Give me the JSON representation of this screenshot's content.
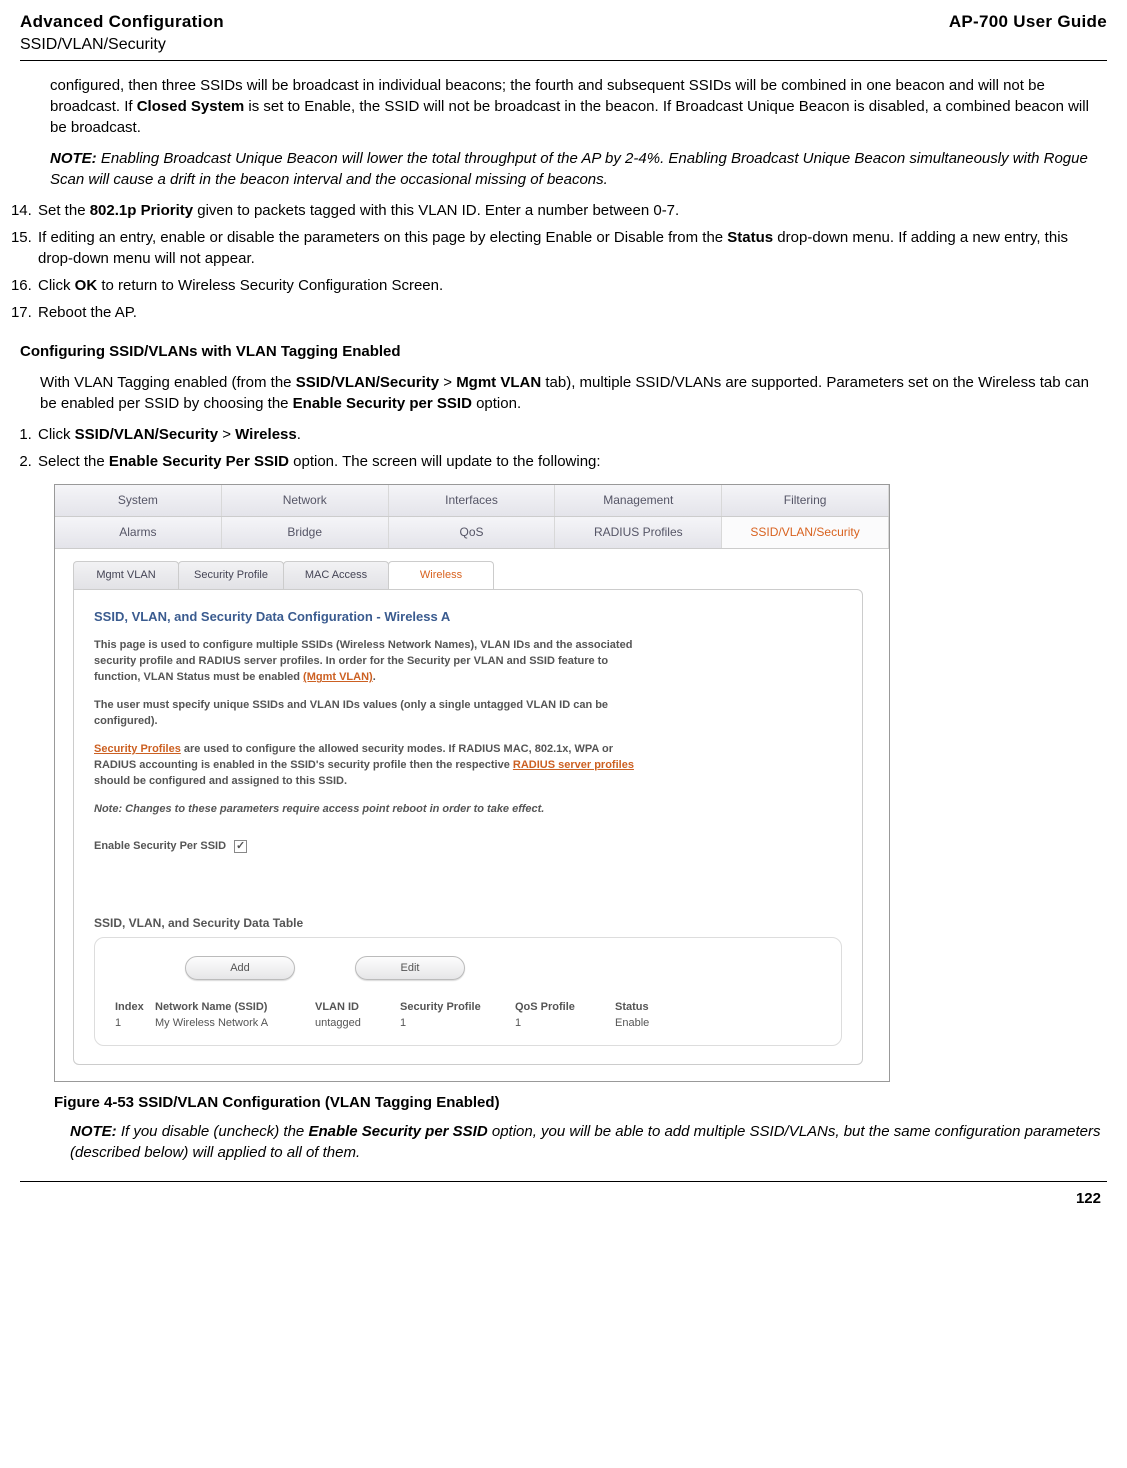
{
  "header": {
    "left_line1": "Advanced Configuration",
    "left_line2": "SSID/VLAN/Security",
    "right": "AP-700 User Guide"
  },
  "intro_para": {
    "p1_a": "configured, then three SSIDs will be broadcast in individual beacons; the fourth and subsequent SSIDs will be combined in one beacon and will not be broadcast. If ",
    "p1_bold1": "Closed System",
    "p1_b": " is set to Enable, the SSID will not be broadcast in the beacon. If Broadcast Unique Beacon is disabled, a combined beacon will be broadcast."
  },
  "note1": {
    "label": "NOTE:",
    "text": " Enabling Broadcast Unique Beacon will lower the total throughput of the AP by 2-4%. Enabling Broadcast Unique Beacon simultaneously with Rogue Scan will cause a drift in the beacon interval and the occasional missing of beacons."
  },
  "steps_a": {
    "s14_a": "Set the ",
    "s14_bold": "802.1p Priority",
    "s14_b": " given to packets tagged with this VLAN ID. Enter a number between 0-7.",
    "s15_a": "If editing an entry, enable or disable the parameters on this page by electing Enable or Disable from the ",
    "s15_bold": "Status",
    "s15_b": " drop-down menu. If adding a new entry, this drop-down menu will not appear.",
    "s16_a": "Click ",
    "s16_bold": "OK",
    "s16_b": " to return to Wireless Security Configuration Screen.",
    "s17": "Reboot the AP."
  },
  "section_heading": "Configuring SSID/VLANs with VLAN Tagging Enabled",
  "para2_a": "With VLAN Tagging enabled (from the ",
  "para2_b1": "SSID/VLAN/Security",
  "para2_gt": " > ",
  "para2_b2": "Mgmt VLAN",
  "para2_b": " tab), multiple SSID/VLANs are supported. Parameters set on the Wireless tab can be enabled per SSID by choosing the ",
  "para2_b3": "Enable Security per SSID",
  "para2_c": " option.",
  "steps_b": {
    "s1_a": "Click ",
    "s1_b1": "SSID/VLAN/Security",
    "s1_gt": " > ",
    "s1_b2": "Wireless",
    "s1_end": ".",
    "s2_a": "Select the ",
    "s2_b1": "Enable Security Per SSID",
    "s2_b": " option. The screen will update to the following:"
  },
  "screenshot": {
    "tabs1": [
      "System",
      "Network",
      "Interfaces",
      "Management",
      "Filtering"
    ],
    "tabs2": [
      "Alarms",
      "Bridge",
      "QoS",
      "RADIUS Profiles",
      "SSID/VLAN/Security"
    ],
    "subtabs": [
      "Mgmt VLAN",
      "Security Profile",
      "MAC Access",
      "Wireless"
    ],
    "panel_title": "SSID, VLAN, and Security Data Configuration - Wireless A",
    "t1_a": "This page is used to configure multiple SSIDs (Wireless Network Names), VLAN IDs and the associated security profile and RADIUS server profiles. In order for the Security per VLAN and SSID feature to function, VLAN Status must be enabled ",
    "t1_link": "(Mgmt VLAN)",
    "t1_b": ".",
    "t2": "The user must specify unique SSIDs and VLAN IDs values (only a single untagged VLAN ID can be configured).",
    "t3_link1": "Security Profiles",
    "t3_a": " are used to configure the allowed security modes. If RADIUS MAC, 802.1x, WPA or RADIUS accounting is enabled in the SSID's security profile then the respective ",
    "t3_link2": "RADIUS server profiles",
    "t3_b": " should be configured and assigned to this SSID.",
    "note": "Note: Changes to these parameters require access point reboot in order to take effect.",
    "checkbox_label": "Enable Security Per SSID",
    "checkbox_checked": "✓",
    "table_title": "SSID, VLAN, and Security Data Table",
    "btn_add": "Add",
    "btn_edit": "Edit",
    "headers": {
      "c1": "Index",
      "c2": "Network Name (SSID)",
      "c3": "VLAN ID",
      "c4": "Security Profile",
      "c5": "QoS Profile",
      "c6": "Status"
    },
    "row": {
      "c1": "1",
      "c2": "My Wireless Network A",
      "c3": "untagged",
      "c4": "1",
      "c5": "1",
      "c6": "Enable"
    }
  },
  "figure_caption": "Figure 4-53 SSID/VLAN Configuration (VLAN Tagging Enabled)",
  "note2": {
    "label": "NOTE:",
    "a": " If you disable (uncheck) the ",
    "bold": "Enable Security per SSID",
    "b": " option, you will be able to add multiple SSID/VLANs, but the same configuration parameters (described below) will applied to all of them."
  },
  "page_number": "122"
}
